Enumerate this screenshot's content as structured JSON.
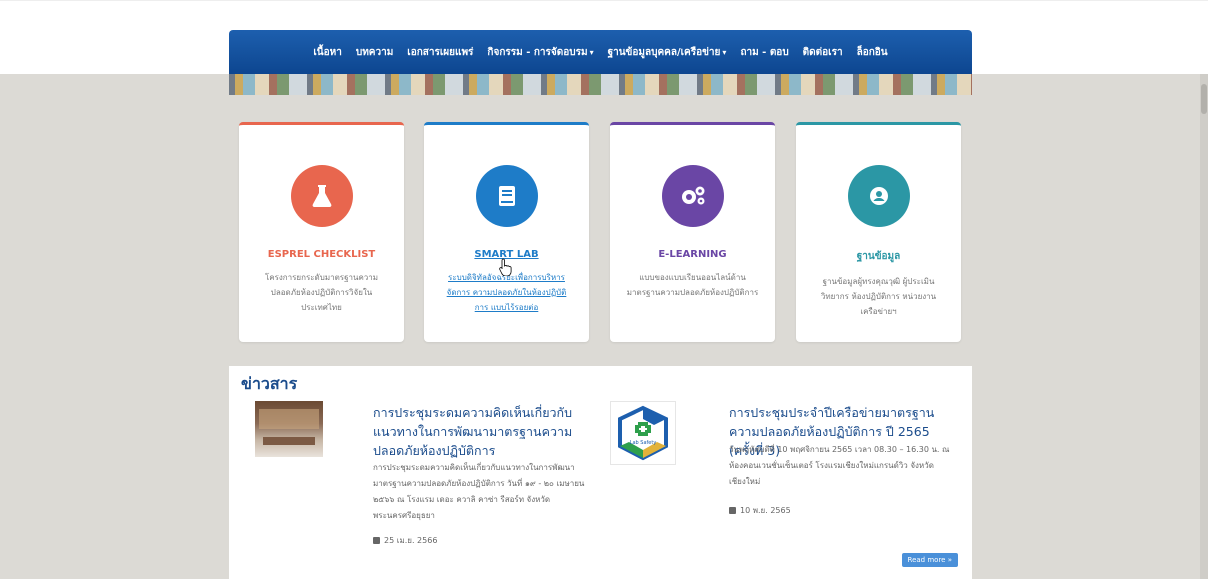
{
  "nav": {
    "items": [
      {
        "label": "เนื้อหา",
        "caret": false
      },
      {
        "label": "บทความ",
        "caret": false
      },
      {
        "label": "เอกสารเผยแพร่",
        "caret": false
      },
      {
        "label": "กิจกรรม - การจัดอบรม",
        "caret": true
      },
      {
        "label": "ฐานข้อมูลบุคคล/เครือข่าย",
        "caret": true
      },
      {
        "label": "ถาม - ตอบ",
        "caret": false
      },
      {
        "label": "ติดต่อเรา",
        "caret": false
      },
      {
        "label": "ล็อกอิน",
        "caret": false
      }
    ]
  },
  "cards": [
    {
      "title": "ESPREL CHECKLIST",
      "desc": "โครงการยกระดับมาตรฐานความปลอดภัยห้องปฏิบัติการวิจัยในประเทศไทย",
      "color": "#e8664e",
      "icon": "flask-icon"
    },
    {
      "title": "SMART LAB",
      "desc": "ระบบดิจิทัลอัจฉริยะเพื่อการบริหารจัดการ ความปลอดภัยในห้องปฏิบัติการ แบบไร้รอยต่อ",
      "color": "#1e7cc8",
      "icon": "book-icon"
    },
    {
      "title": "E-LEARNING",
      "desc": "แบบของแบบเรียนออนไลน์ด้านมาตรฐานความปลอดภัยห้องปฏิบัติการ",
      "color": "#6a46a5",
      "icon": "gears-icon"
    },
    {
      "title": "ฐานข้อมูล",
      "desc": "ฐานข้อมูลผู้ทรงคุณวุฒิ ผู้ประเมิน วิทยากร ห้องปฏิบัติการ หน่วยงาน เครือข่ายฯ",
      "color": "#2b97a5",
      "icon": "user-circle-icon"
    }
  ],
  "news": {
    "heading": "ข่าวสาร",
    "items": [
      {
        "title": "การประชุมระดมความคิดเห็นเกี่ยวกับแนวทางในการพัฒนามาตรฐานความปลอดภัยห้องปฏิบัติการ",
        "desc": "การประชุมระดมความคิดเห็นเกี่ยวกับแนวทางในการพัฒนามาตรฐานความปลอดภัยห้องปฏิบัติการ วันที่ ๑๙ - ๒๐ เมษายน ๒๕๖๖ ณ โรงแรม เดอะ ควาลิ คาซ่า รีสอร์ท จังหวัดพระนครศรีอยุธยา",
        "date": "25 เม.ย. 2566"
      },
      {
        "title": "การประชุมประจำปีเครือข่ายมาตรฐานความปลอดภัยห้องปฏิบัติการ ปี 2565 (ครั้งที่ 3)",
        "desc": "วันพฤหัสบดีที่ 10 พฤศจิกายน 2565 เวลา 08.30 – 16.30 น. ณ ห้องคอนเวนชั่นเซ็นเตอร์ โรงแรมเชียงใหม่แกรนด์วิว จังหวัดเชียงใหม่",
        "date": "10 พ.ย. 2565",
        "logo_text": "Lab Safety"
      }
    ],
    "readmore": "Read more »"
  },
  "colors": {
    "nav": "#0d4690",
    "newsTitle": "#1b4c8c",
    "readmore": "#4a90d9"
  }
}
